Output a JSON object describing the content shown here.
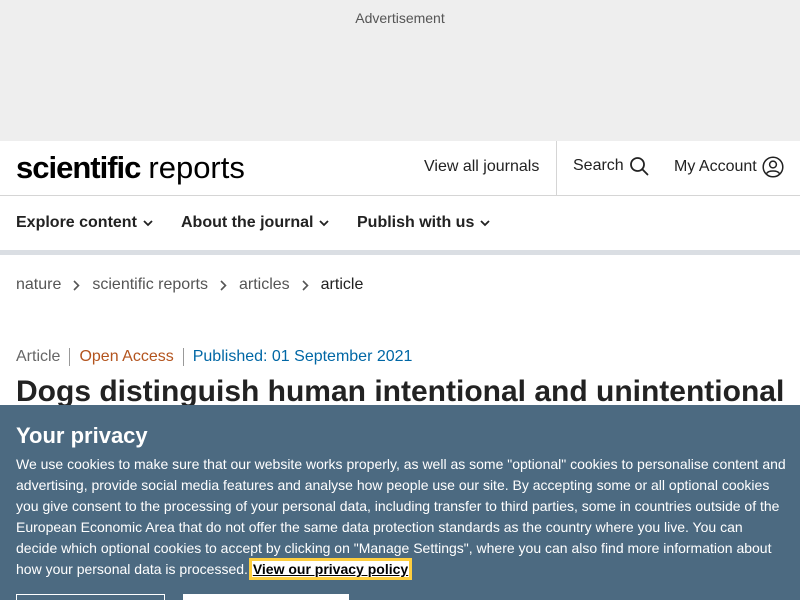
{
  "ad": {
    "label": "Advertisement"
  },
  "header": {
    "logo_bold": "scientific",
    "logo_light": "reports",
    "view_all_journals": "View all journals",
    "search_label": "Search",
    "account_label": "My Account"
  },
  "nav": {
    "items": [
      {
        "label": "Explore content"
      },
      {
        "label": "About the journal"
      },
      {
        "label": "Publish with us"
      }
    ]
  },
  "breadcrumb": {
    "items": [
      {
        "label": "nature"
      },
      {
        "label": "scientific reports"
      },
      {
        "label": "articles"
      },
      {
        "label": "article"
      }
    ]
  },
  "article": {
    "type": "Article",
    "access": "Open Access",
    "published": "Published: 01 September 2021",
    "title": "Dogs distinguish human intentional and unintentional"
  },
  "privacy": {
    "heading": "Your privacy",
    "body": "We use cookies to make sure that our website works properly, as well as some \"optional\" cookies to personalise content and advertising, provide social media features and analyse how people use our site. By accepting some or all optional cookies you give consent to the processing of your personal data, including transfer to third parties, some in countries outside of the European Economic Area that do not offer the same data protection standards as the country where you live. You can decide which optional cookies to accept by clicking on \"Manage Settings\", where you can also find more information about how your personal data is processed. ",
    "policy_link": "View our privacy policy"
  },
  "colors": {
    "privacy_bg": "#4c6a81",
    "open_access": "#b3541e",
    "published": "#0067a5",
    "focus_outline": "#fece3e"
  }
}
